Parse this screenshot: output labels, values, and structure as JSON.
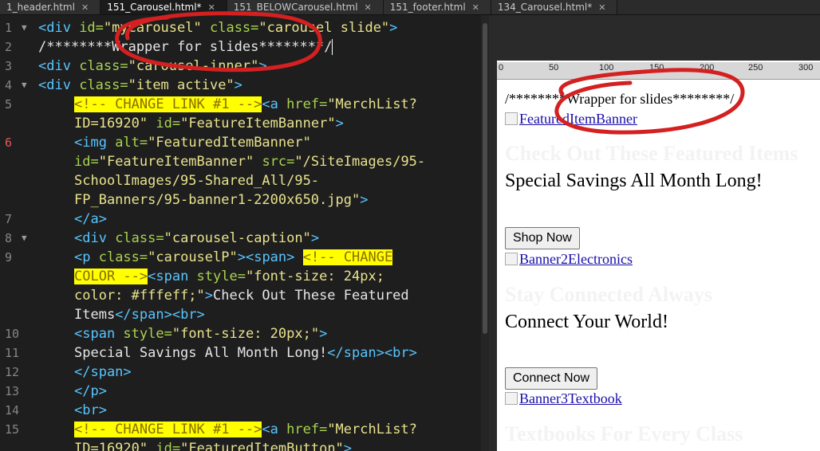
{
  "tabs": [
    {
      "label": "1_header.html",
      "active": false
    },
    {
      "label": "151_Carousel.html*",
      "active": true
    },
    {
      "label": "151_BELOWCarousel.html",
      "active": false
    },
    {
      "label": "151_footer.html",
      "active": false
    },
    {
      "label": "134_Carousel.html*",
      "active": false
    }
  ],
  "editor": {
    "line_numbers": [
      "1",
      "2",
      "3",
      "4",
      "5",
      "6",
      "7",
      "8",
      "9",
      "10",
      "11",
      "12",
      "13",
      "14",
      "15"
    ],
    "error_line": "6",
    "lines": {
      "l1": {
        "open": "<div ",
        "a1": "id=",
        "v1": "\"myCarousel\"",
        "sp": " ",
        "a2": "class=",
        "v2": "\"carousel slide\"",
        "close": ">"
      },
      "l2": {
        "text": "/********Wrapper for slides********/"
      },
      "l3": {
        "open": "<div ",
        "a1": "class=",
        "v1": "\"carousel-inner\"",
        "close": ">"
      },
      "l4": {
        "open": "<div ",
        "a1": "class=",
        "v1": "\"item active\"",
        "close": ">"
      },
      "l5": {
        "cmt": "<!-- CHANGE LINK #1 -->",
        "open": "<a ",
        "a1": "href=",
        "v1": "\"MerchList?"
      },
      "l5b": {
        "v1": "ID=16920\"",
        "sp": " ",
        "a2": "id=",
        "v2": "\"FeatureItemBanner\"",
        "close": ">"
      },
      "l6": {
        "open": "<img ",
        "a1": "alt=",
        "v1": "\"FeaturedItemBanner\""
      },
      "l6b": {
        "a1": "id=",
        "v1": "\"FeatureItemBanner\"",
        "sp": " ",
        "a2": "src=",
        "v2": "\"/SiteImages/95-"
      },
      "l6c": {
        "v1": "SchoolImages/95-Shared_All/95-"
      },
      "l6d": {
        "v1": "FP_Banners/95-banner1-2200x650.jpg\"",
        "close": ">"
      },
      "l7": {
        "tag": "</a>"
      },
      "l8": {
        "open": "<div ",
        "a1": "class=",
        "v1": "\"carousel-caption\"",
        "close": ">"
      },
      "l9": {
        "open": "<p ",
        "a1": "class=",
        "v1": "\"carouselP\"",
        "close": "><span>",
        "sp": " ",
        "cmt": "<!-- CHANGE"
      },
      "l9b": {
        "cmt": "COLOR -->",
        "open": "<span ",
        "a1": "style=",
        "v1": "\"font-size: 24px;"
      },
      "l9c": {
        "v1": "color: #fffeff;\"",
        "close": ">",
        "txt": "Check Out These Featured"
      },
      "l9d": {
        "txt": "Items",
        "tag": "</span><br>"
      },
      "l10": {
        "open": "<span ",
        "a1": "style=",
        "v1": "\"font-size: 20px;\"",
        "close": ">"
      },
      "l11": {
        "txt": "Special Savings All Month Long!",
        "tag": "</span><br>"
      },
      "l12": {
        "tag": "</span>"
      },
      "l13": {
        "tag": "</p>"
      },
      "l14": {
        "tag": "<br>"
      },
      "l15": {
        "cmt": "<!-- CHANGE LINK #1 -->",
        "open": "<a ",
        "a1": "href=",
        "v1": "\"MerchList?"
      },
      "l15b": {
        "v1": "ID=16920\"",
        "sp": " ",
        "a2": "id=",
        "v2": "\"FeaturedItemButton\"",
        "close": ">"
      }
    }
  },
  "ruler": {
    "ticks": [
      "0",
      "50",
      "100",
      "150",
      "200",
      "250",
      "300"
    ]
  },
  "preview": {
    "wrapper_text": "/********Wrapper for slides********/",
    "img1_alt": "FeaturedItemBanner",
    "ghost1": "Check Out These Featured Items",
    "savings": "Special Savings All Month Long!",
    "btn1": "Shop Now",
    "img2_alt": "Banner2Electronics",
    "ghost2": "Stay Connected Always",
    "connect": "Connect Your World!",
    "btn2": "Connect Now",
    "img3_alt": "Banner3Textbook",
    "ghost3": "Textbooks For Every Class"
  },
  "colors": {
    "annotation": "#d42020"
  }
}
